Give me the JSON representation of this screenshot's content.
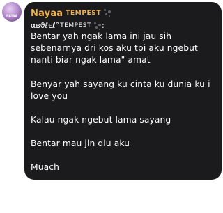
{
  "avatar": {
    "label": "NAYAA"
  },
  "sender": {
    "name": "Nayaa",
    "tag": "TEMPEST"
  },
  "reply": {
    "name": "αвϑℓєℓ°",
    "tag": "TEMPEST",
    "suffix": ":"
  },
  "messages": [
    "Bentar yah ngak lama ini jau sih sebenarnya dri kos aku tpi aku ngebut nanti biar ngak lama\" amat",
    "Benyar yah sayang ku cinta ku dunia ku i love you",
    "Kalau ngak ngebut lama sayang",
    "Bentar mau jln dlu aku",
    "Muach"
  ],
  "colors": {
    "bubble": "#1b1b1d",
    "name": "#f2b24a",
    "text": "#ffffff"
  }
}
